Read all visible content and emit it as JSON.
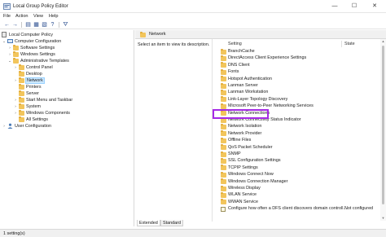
{
  "window": {
    "title": "Local Group Policy Editor",
    "controls": {
      "minimize": "—",
      "maximize": "☐",
      "close": "✕"
    }
  },
  "menu": [
    "File",
    "Action",
    "View",
    "Help"
  ],
  "toolbar": {
    "back_icon": "back-arrow-icon",
    "forward_icon": "forward-arrow-icon",
    "filter_icon": "filter-icon"
  },
  "tree": [
    {
      "label": "Local Computer Policy",
      "icon": "computer-policy",
      "toggle": ""
    },
    {
      "label": "Computer Configuration",
      "icon": "computer",
      "toggle": "v"
    },
    {
      "label": "Software Settings",
      "icon": "folder",
      "toggle": ">"
    },
    {
      "label": "Windows Settings",
      "icon": "folder",
      "toggle": ">"
    },
    {
      "label": "Administrative Templates",
      "icon": "folder",
      "toggle": "v"
    },
    {
      "label": "Control Panel",
      "icon": "folder",
      "toggle": ">"
    },
    {
      "label": "Desktop",
      "icon": "folder",
      "toggle": ""
    },
    {
      "label": "Network",
      "icon": "folder",
      "toggle": ">",
      "selected": true
    },
    {
      "label": "Printers",
      "icon": "folder",
      "toggle": ""
    },
    {
      "label": "Server",
      "icon": "folder",
      "toggle": ""
    },
    {
      "label": "Start Menu and Taskbar",
      "icon": "folder",
      "toggle": ">"
    },
    {
      "label": "System",
      "icon": "folder",
      "toggle": ">"
    },
    {
      "label": "Windows Components",
      "icon": "folder",
      "toggle": ">"
    },
    {
      "label": "All Settings",
      "icon": "folder",
      "toggle": ""
    },
    {
      "label": "User Configuration",
      "icon": "user",
      "toggle": ">"
    }
  ],
  "right_pane": {
    "header": "Network",
    "description": "Select an item to view its description.",
    "columns": {
      "setting": "Setting",
      "state": "State"
    },
    "rows": [
      {
        "label": "BranchCache",
        "type": "folder",
        "state": ""
      },
      {
        "label": "DirectAccess Client Experience Settings",
        "type": "folder",
        "state": ""
      },
      {
        "label": "DNS Client",
        "type": "folder",
        "state": ""
      },
      {
        "label": "Fonts",
        "type": "folder",
        "state": ""
      },
      {
        "label": "Hotspot Authentication",
        "type": "folder",
        "state": ""
      },
      {
        "label": "Lanman Server",
        "type": "folder",
        "state": ""
      },
      {
        "label": "Lanman Workstation",
        "type": "folder",
        "state": ""
      },
      {
        "label": "Link-Layer Topology Discovery",
        "type": "folder",
        "state": ""
      },
      {
        "label": "Microsoft Peer-to-Peer Networking Services",
        "type": "folder",
        "state": ""
      },
      {
        "label": "Network Connections",
        "type": "folder",
        "state": ""
      },
      {
        "label": "Network Connectivity Status Indicator",
        "type": "folder",
        "state": ""
      },
      {
        "label": "Network Isolation",
        "type": "folder",
        "state": ""
      },
      {
        "label": "Network Provider",
        "type": "folder",
        "state": ""
      },
      {
        "label": "Offline Files",
        "type": "folder",
        "state": ""
      },
      {
        "label": "QoS Packet Scheduler",
        "type": "folder",
        "state": ""
      },
      {
        "label": "SNMP",
        "type": "folder",
        "state": ""
      },
      {
        "label": "SSL Configuration Settings",
        "type": "folder",
        "state": ""
      },
      {
        "label": "TCPIP Settings",
        "type": "folder",
        "state": ""
      },
      {
        "label": "Windows Connect Now",
        "type": "folder",
        "state": ""
      },
      {
        "label": "Windows Connection Manager",
        "type": "folder",
        "state": ""
      },
      {
        "label": "Wireless Display",
        "type": "folder",
        "state": ""
      },
      {
        "label": "WLAN Service",
        "type": "folder",
        "state": ""
      },
      {
        "label": "WWAN Service",
        "type": "folder",
        "state": ""
      },
      {
        "label": "Configure how often a DFS client discovers domain controll...",
        "type": "setting",
        "state": "Not configured"
      }
    ],
    "highlighted_row": "Network Connections",
    "highlight_color": "#a52ae6"
  },
  "tabs": [
    {
      "label": "Extended",
      "active": true
    },
    {
      "label": "Standard",
      "active": false
    }
  ],
  "status": "1 setting(s)",
  "colors": {
    "selection": "#cce8ff",
    "folder": "#f2c55c",
    "accent": "#a52ae6"
  }
}
